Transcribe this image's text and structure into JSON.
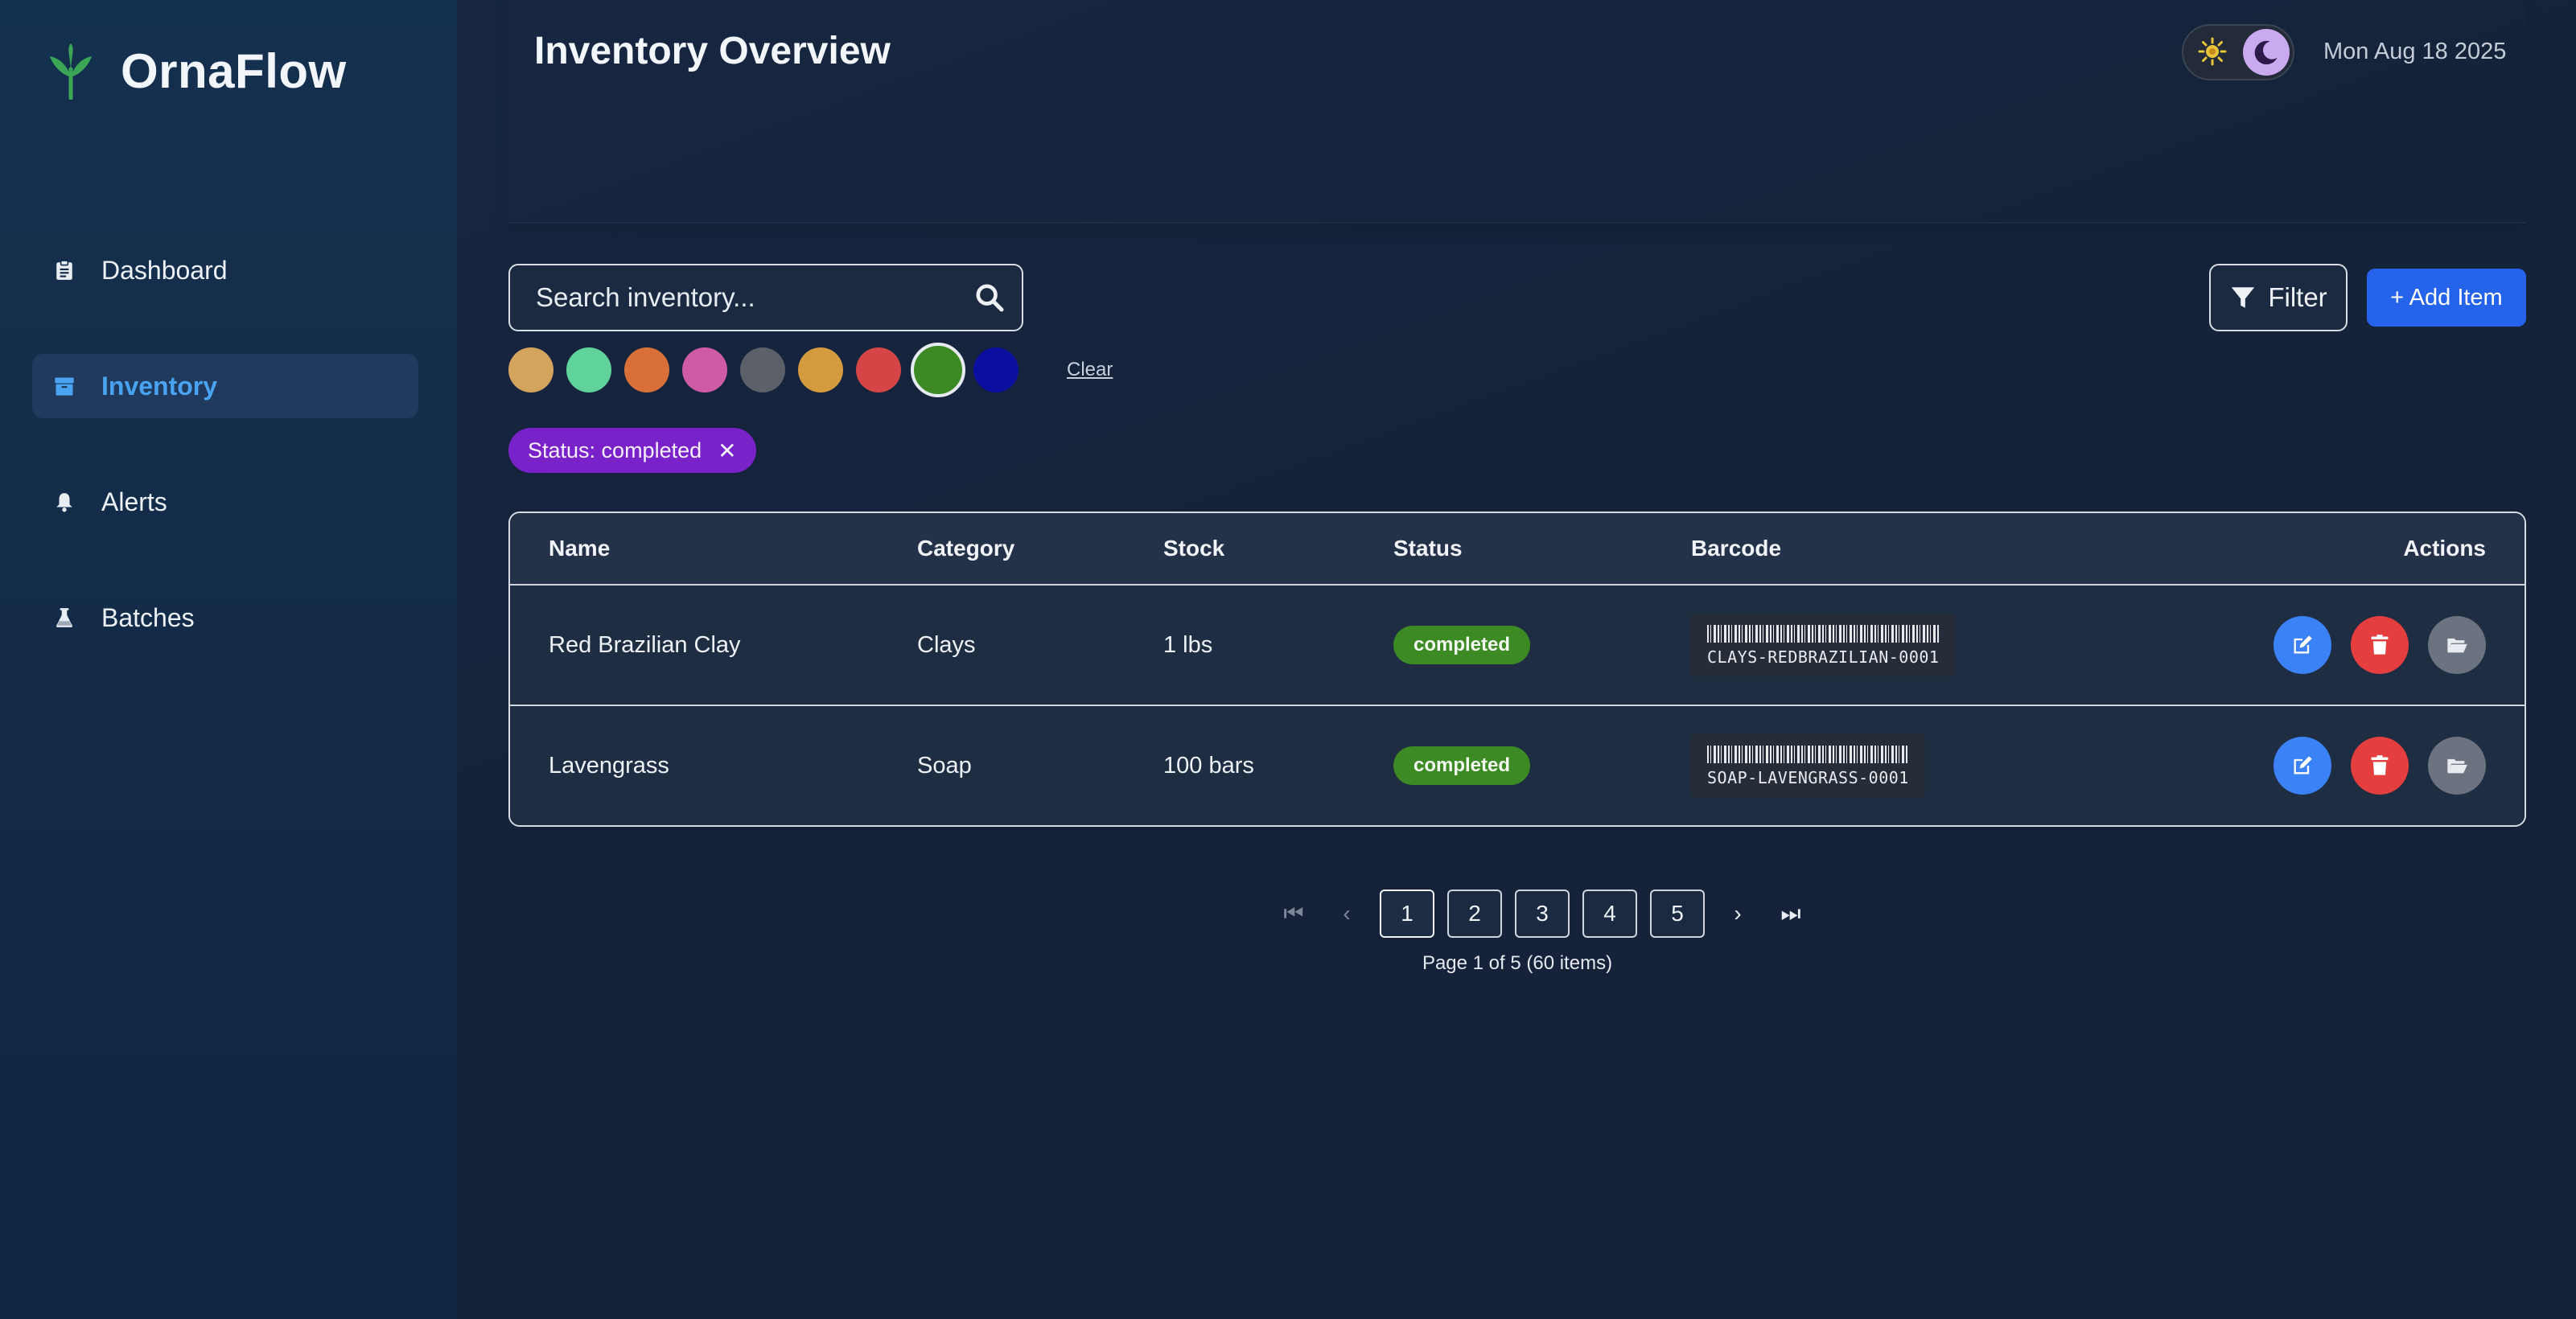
{
  "app": {
    "name": "OrnaFlow"
  },
  "sidebar": {
    "items": [
      {
        "label": "Dashboard",
        "icon": "clipboard-icon",
        "active": false
      },
      {
        "label": "Inventory",
        "icon": "box-icon",
        "active": true
      },
      {
        "label": "Alerts",
        "icon": "bell-icon",
        "active": false
      },
      {
        "label": "Batches",
        "icon": "flask-icon",
        "active": false
      }
    ]
  },
  "header": {
    "title": "Inventory Overview",
    "date": "Mon Aug 18 2025",
    "theme_toggle": {
      "icons": [
        "sun-icon",
        "moon-icon"
      ],
      "mode": "dark"
    }
  },
  "toolbar": {
    "search_placeholder": "Search inventory...",
    "filter_label": "Filter",
    "add_label": "+ Add Item",
    "clear_label": "Clear",
    "swatches": [
      "#d4a35e",
      "#5fd39a",
      "#d9703a",
      "#cf5aa5",
      "#5c6068",
      "#d69a3e",
      "#d64545",
      "#3c8a24",
      "#0a0fa0"
    ],
    "selected_swatch": 7,
    "active_filter": "Status: completed"
  },
  "table": {
    "headers": {
      "name": "Name",
      "category": "Category",
      "stock": "Stock",
      "status": "Status",
      "barcode": "Barcode",
      "actions": "Actions"
    },
    "rows": [
      {
        "name": "Red Brazilian Clay",
        "category": "Clays",
        "stock": "1 lbs",
        "status": "completed",
        "barcode": "CLAYS-REDBRAZILIAN-0001"
      },
      {
        "name": "Lavengrass",
        "category": "Soap",
        "stock": "100 bars",
        "status": "completed",
        "barcode": "SOAP-LAVENGRASS-0001"
      }
    ]
  },
  "pagination": {
    "pages": [
      "1",
      "2",
      "3",
      "4",
      "5"
    ],
    "current": "1",
    "first": "⏮",
    "prev": "‹",
    "next": "›",
    "last": "⏭",
    "info": "Page 1 of 5 (60 items)"
  },
  "colors": {
    "accent": "#2563eb",
    "chip": "#7a22c9",
    "status_completed": "#3b8a24",
    "nav_active_text": "#4aa3f0"
  }
}
